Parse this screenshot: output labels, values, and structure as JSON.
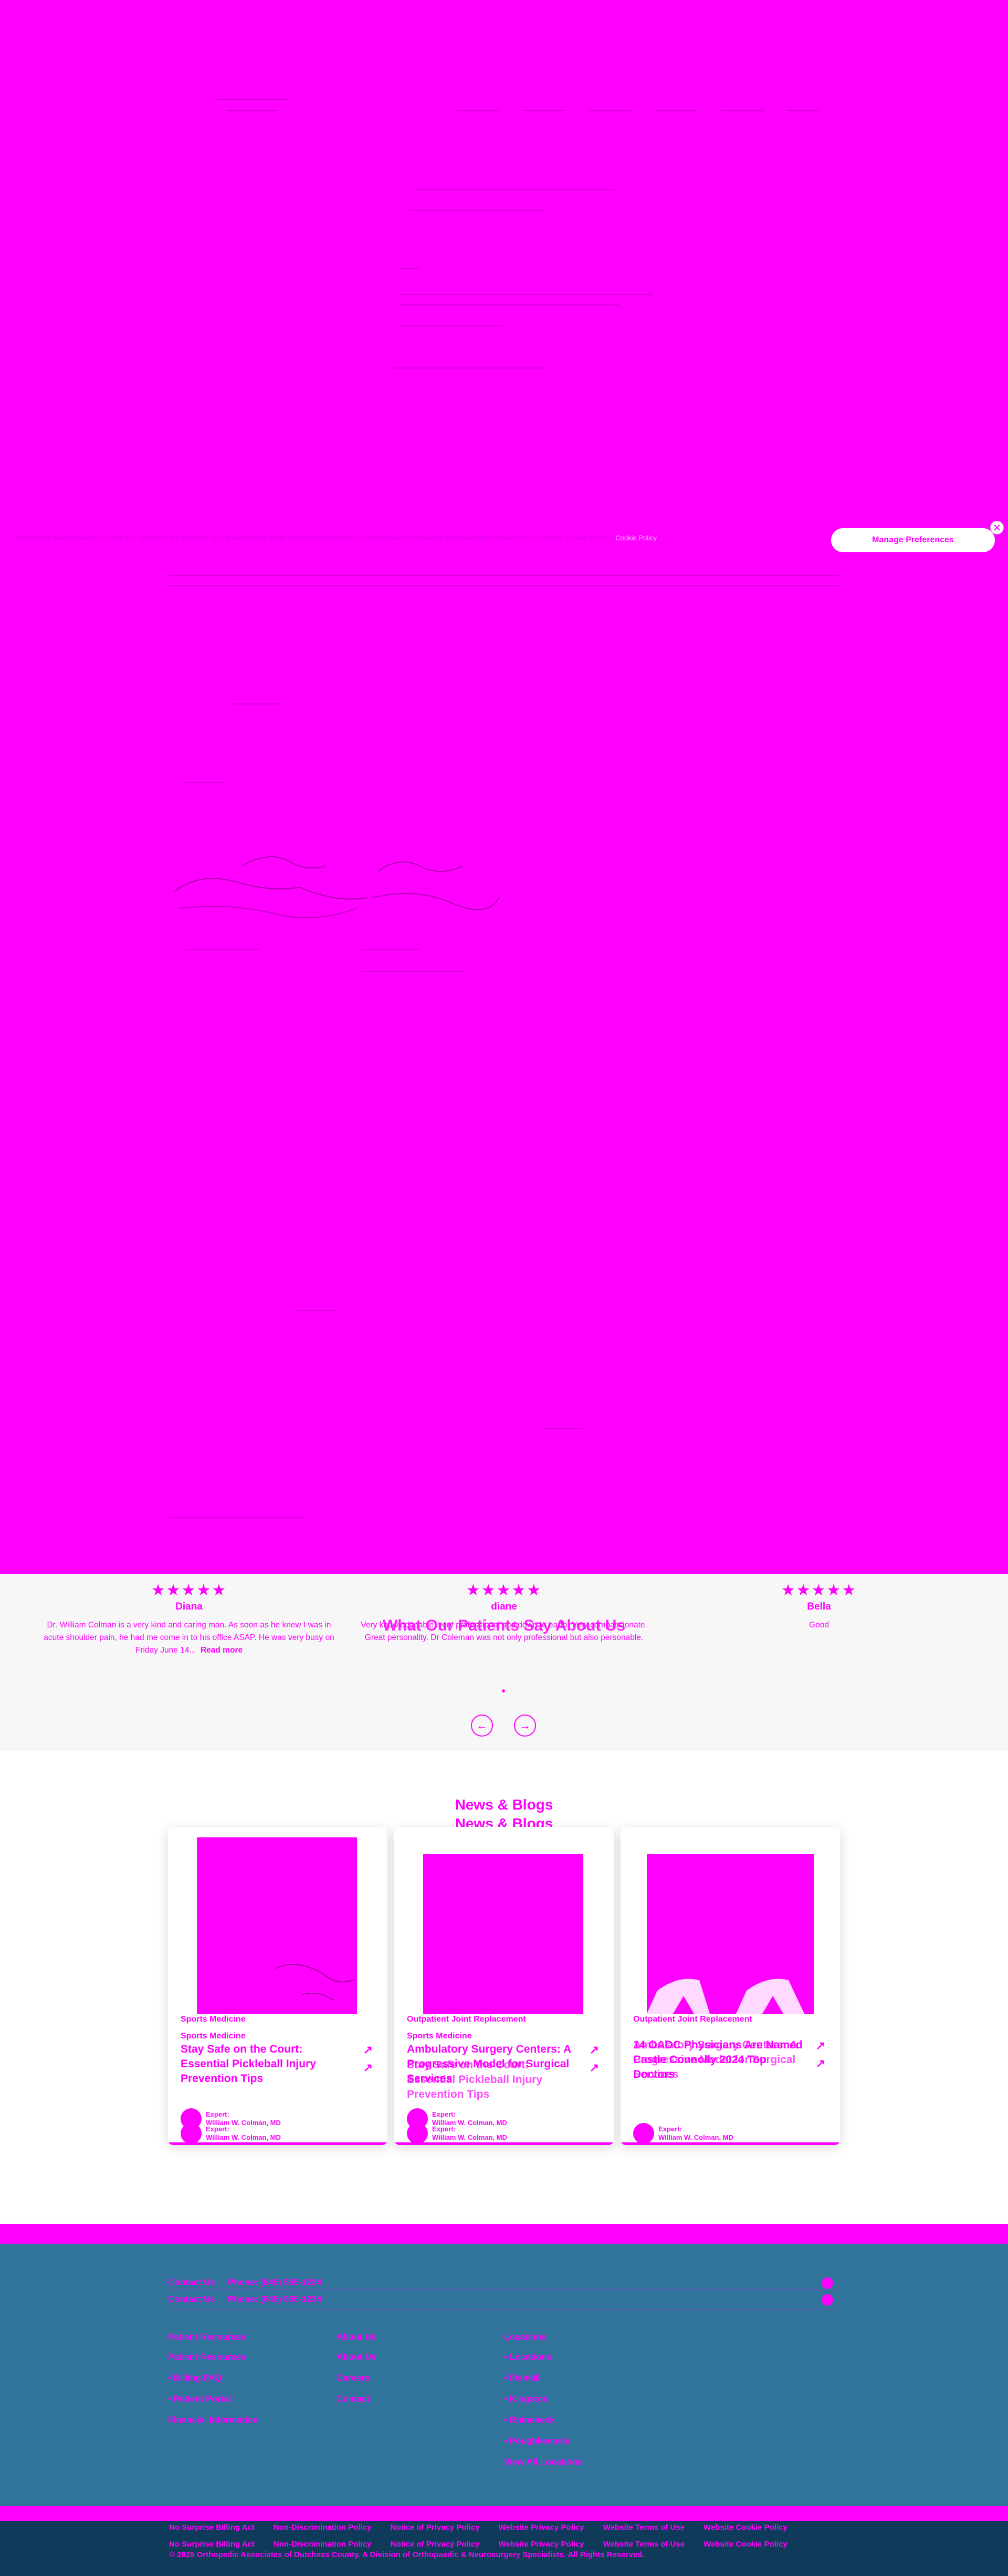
{
  "header": {
    "nav": [
      "",
      "",
      "",
      "",
      "",
      ""
    ]
  },
  "cookie": {
    "text": "This website uses cookies to ensure you get the best experience on our website. By using this site, you accept our use of cookies for analytics, personalization and ads. For more info, please visit our",
    "link_label": "Cookie Policy",
    "button_label": "Manage Preferences"
  },
  "testimonials": {
    "title": "What Our Patients Say About Us",
    "items": [
      {
        "stars": "★★★★★",
        "name": "Diana",
        "text": "Dr. William Colman is a very kind and caring man. As soon as he knew I was in acute shoulder pain, he had me come in to his office ASAP. He was very busy on Friday June 14...",
        "read_more": "Read more"
      },
      {
        "stars": "★★★★★",
        "name": "diane",
        "text": "Very knowledgeable, very professional and down to earth. Very compassionate. Great personality. Dr Coleman was not only professional but also personable.",
        "read_more": ""
      },
      {
        "stars": "★★★★★",
        "name": "Bella",
        "text": "Good",
        "read_more": ""
      }
    ],
    "prev_arrow": "←",
    "next_arrow": "→"
  },
  "news": {
    "title_line1": "News & Blogs",
    "title_line2": "News & Blogs",
    "cards": [
      {
        "category": "Sports Medicine",
        "category_dup": "Sports Medicine",
        "title": "Stay Safe on the Court: Essential Pickleball Injury Prevention Tips",
        "title_ghost": "Stay Safe on the Court: Essential Pickleball Injury Prevention Tips",
        "arrow": "↗",
        "expert_label": "Expert:",
        "expert_name": "William W. Colman, MD"
      },
      {
        "category": "Outpatient Joint Replacement",
        "category_dup": "Sports Medicine",
        "title": "Ambulatory Surgery Centers: A Progressive Model for Surgical Services",
        "title_ghost": "Stay Safe on the Court: Essential Pickleball Injury Prevention Tips",
        "arrow": "↗",
        "expert_label": "Expert:",
        "expert_name": "William W. Colman, MD"
      },
      {
        "category": "Outpatient Joint Replacement",
        "category_dup": "",
        "title": "14 OADC Physicians Are Named Castle Connolly 2024 Top Doctors",
        "title_ghost": "Ambulatory Surgery Centers: A Progressive Model for Surgical Services",
        "arrow": "↗",
        "expert_label": "Expert:",
        "expert_name": "William W. Colman, MD"
      }
    ]
  },
  "footer": {
    "contact": [
      {
        "label": "Contact Us",
        "value": "Phone: (845) 555-1234"
      },
      {
        "label": "Contact Us",
        "value": "Phone: (845) 555-1234"
      }
    ],
    "columns": [
      {
        "heading": "Patient Resources",
        "items": [
          "Patient Resources",
          "• Billing FAQ",
          "• Patient Portal",
          "Financial Information"
        ]
      },
      {
        "heading": "About Us",
        "items": [
          "About Us",
          "Careers",
          "Contact"
        ]
      },
      {
        "heading": "Locations",
        "items": [
          "• Locations",
          "• Fishkill",
          "• Kingston",
          "• Rhinebeck",
          "• Poughkeepsie",
          "View All Locations"
        ]
      }
    ]
  },
  "bottom": {
    "links_row1": [
      "No Surprise Billing Act",
      "Non-Discrimination Policy",
      "Notice of Privacy Policy",
      "Website Privacy Policy",
      "Website Terms of Use",
      "Website Cookie Policy"
    ],
    "links_row2": [
      "No Surprise Billing Act",
      "Non-Discrimination Policy",
      "Notice of Privacy Policy",
      "Website Privacy Policy",
      "Website Terms of Use",
      "Website Cookie Policy"
    ],
    "copyright": "© 2025 Orthopedic Associates of Dutchess County. A Division of Orthopaedic & Neurosurgery Specialists. All Rights Reserved."
  }
}
